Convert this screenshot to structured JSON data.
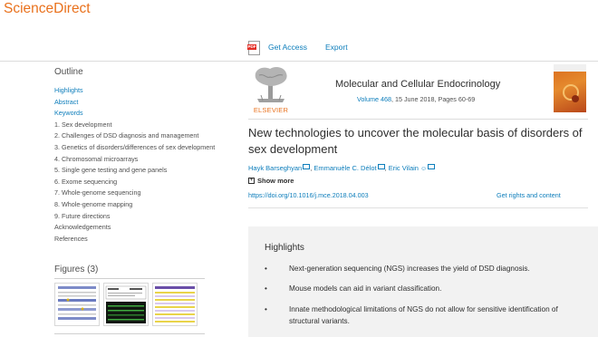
{
  "brand": "ScienceDirect",
  "toolbar": {
    "pdf_icon_text": "PDF",
    "get_access": "Get Access",
    "export": "Export"
  },
  "outline": {
    "heading": "Outline",
    "items": [
      "Highlights",
      "Abstract",
      "Keywords",
      "1. Sex development",
      "2. Challenges of DSD diagnosis and management",
      "3. Genetics of disorders/differences of sex development",
      "4. Chromosomal microarrays",
      "5. Single gene testing and gene panels",
      "6. Exome sequencing",
      "7. Whole-genome sequencing",
      "8. Whole-genome mapping",
      "9. Future directions",
      "Acknowledgements",
      "References"
    ]
  },
  "figures": {
    "heading": "Figures (3)"
  },
  "journal": {
    "publisher_logo_text": "ELSEVIER",
    "name": "Molecular and Cellular Endocrinology",
    "volume": "Volume 468",
    "date_pages": ", 15 June 2018, Pages 60-69"
  },
  "article": {
    "title": "New technologies to uncover the molecular basis of disorders of sex development",
    "authors": [
      "Hayk Barseghyan",
      "Emmanuèle C. Délot",
      "Eric Vilain"
    ],
    "show_more": "Show more",
    "doi": "https://doi.org/10.1016/j.mce.2018.04.003",
    "rights": "Get rights and content"
  },
  "highlights": {
    "heading": "Highlights",
    "bullet": "•",
    "items": [
      "Next-generation sequencing (NGS) increases the yield of DSD diagnosis.",
      "Mouse models can aid in variant classification.",
      "Innate methodological limitations of NGS do not allow for sensitive identification of structural variants."
    ]
  },
  "colors": {
    "brand": "#e9711c",
    "link": "#0c7dbb",
    "panel": "#f2f2f2"
  }
}
